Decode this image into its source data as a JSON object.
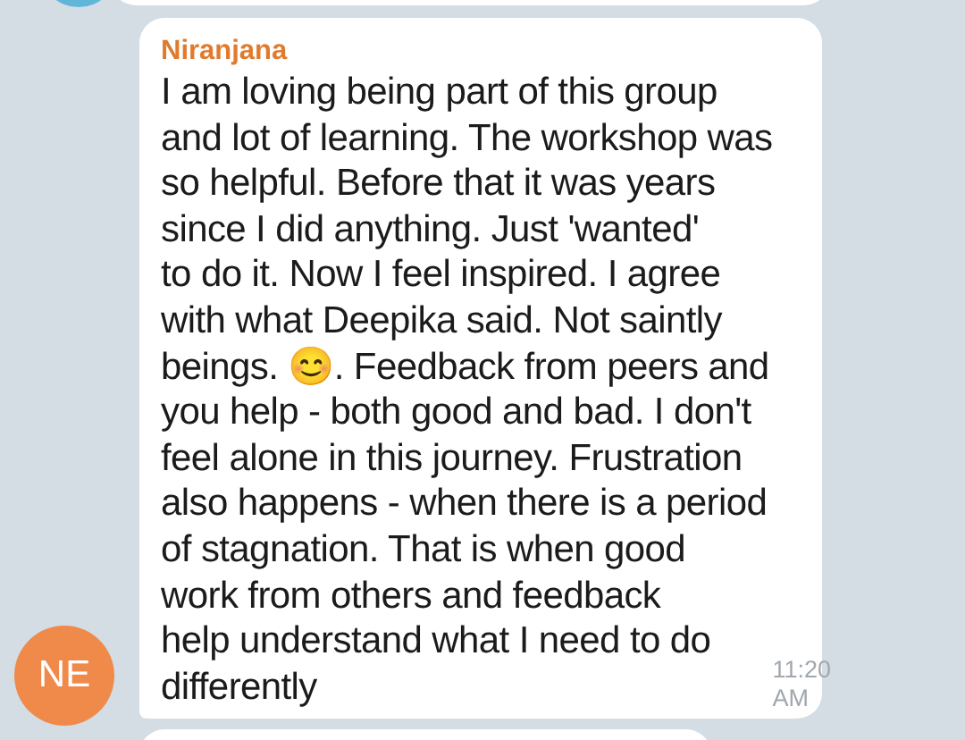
{
  "message": {
    "sender": "Niranjana",
    "avatar_initials": "NE",
    "text_lines": [
      "I am loving being part of this group",
      "and lot of learning. The workshop was",
      "so helpful. Before that it was years",
      "since I did anything. Just 'wanted'",
      "to do it. Now I feel inspired. I agree",
      "with what Deepika said. Not saintly",
      "beings. 😊. Feedback from peers and",
      "you help - both good and bad. I don't",
      "feel alone in this journey. Frustration",
      "also happens - when there is a period",
      "of stagnation. That is when good",
      "work from others and feedback",
      "help understand what I need to do",
      "differently"
    ],
    "time": "11:20 AM"
  }
}
